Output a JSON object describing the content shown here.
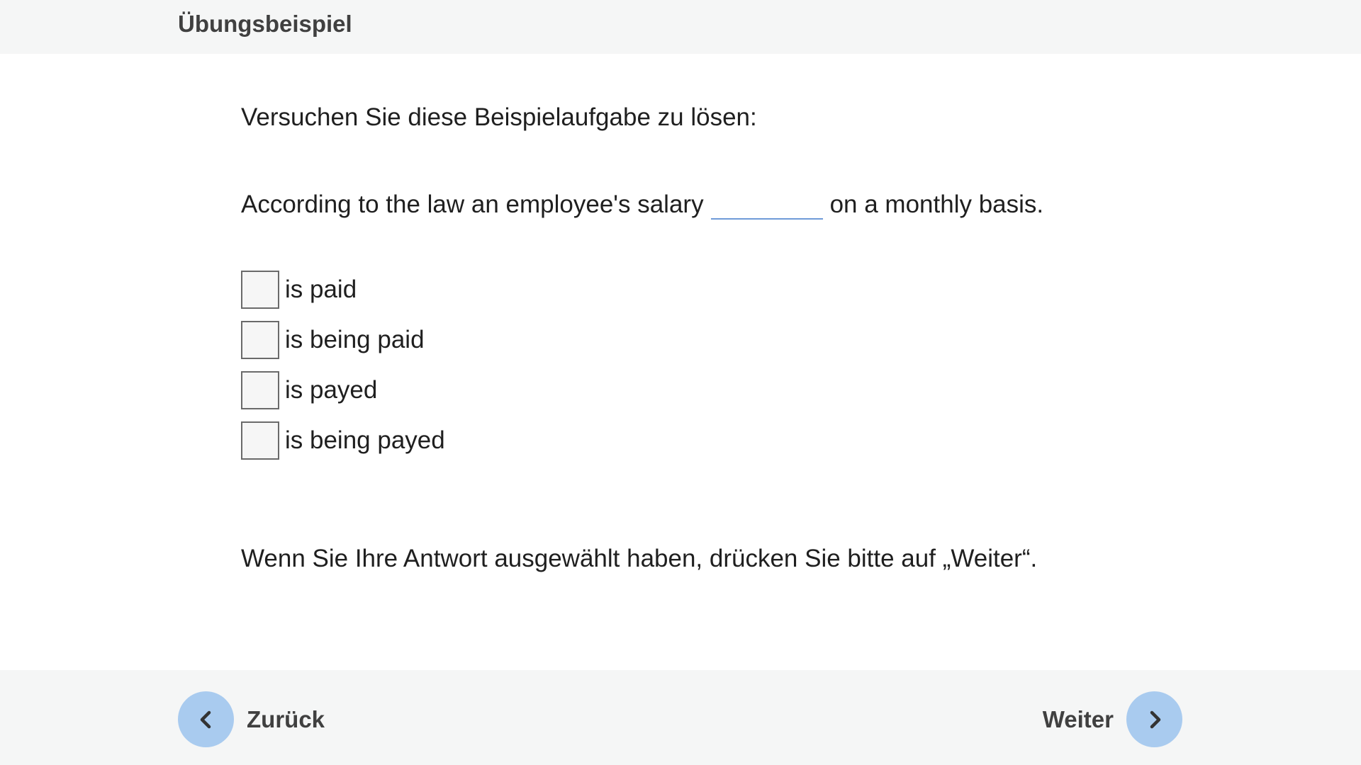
{
  "header": {
    "title": "Übungsbeispiel"
  },
  "main": {
    "instruction": "Versuchen Sie diese Beispielaufgabe zu lösen:",
    "question_before": "According to the law an employee's salary",
    "question_after": "on a monthly basis.",
    "options": [
      {
        "label": "is paid",
        "checked": false
      },
      {
        "label": "is being paid",
        "checked": false
      },
      {
        "label": "is payed",
        "checked": false
      },
      {
        "label": "is being payed",
        "checked": false
      }
    ],
    "note": "Wenn Sie Ihre Antwort ausgewählt haben, drücken Sie bitte auf „Weiter“."
  },
  "footer": {
    "back_label": "Zurück",
    "next_label": "Weiter",
    "back_icon": "chevron-left-icon",
    "next_icon": "chevron-right-icon"
  },
  "colors": {
    "accent": "#a9cbef",
    "blank_line": "#6f9ad8",
    "bar_background": "#f5f6f6"
  }
}
